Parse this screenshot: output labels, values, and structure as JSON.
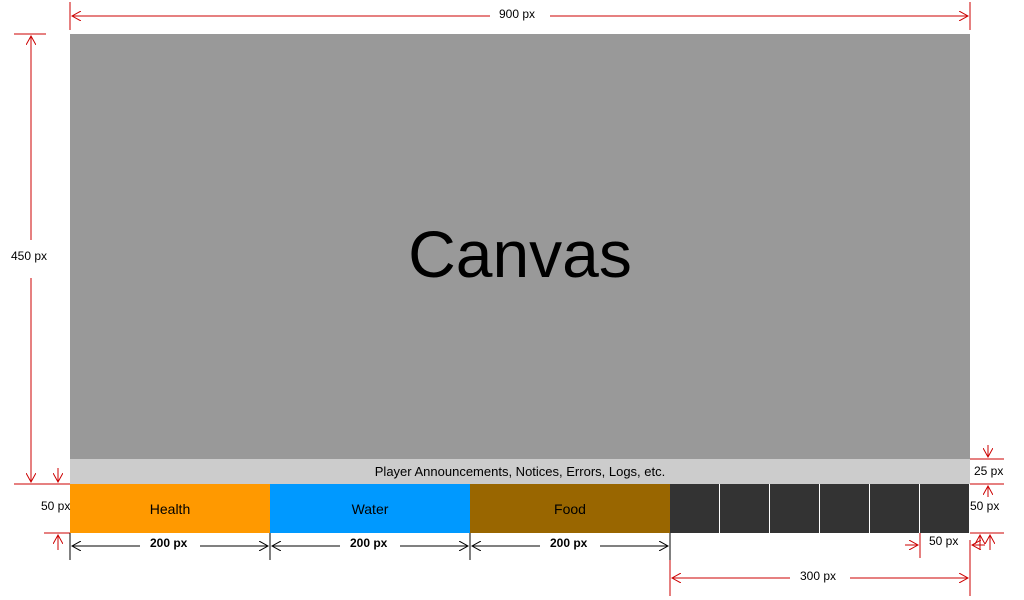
{
  "canvas": {
    "label": "Canvas"
  },
  "announcement_bar": {
    "label": "Player Announcements, Notices, Errors, Logs, etc."
  },
  "status_bars": {
    "health": "Health",
    "water": "Water",
    "food": "Food"
  },
  "colors": {
    "canvas": "#999999",
    "announcement": "#cccccc",
    "health": "#ff9900",
    "water": "#0099ff",
    "food": "#996600",
    "inventory_slot": "#333333",
    "dimension_line": "#cc0000"
  },
  "dimensions": {
    "total_width": "900 px",
    "canvas_height": "450 px",
    "announcement_height": "25 px",
    "bar_height_left": "50 px",
    "bar_height_right": "50 px",
    "health_width": "200 px",
    "water_width": "200 px",
    "food_width": "200 px",
    "slot_width": "50 px",
    "inventory_width": "300 px"
  }
}
